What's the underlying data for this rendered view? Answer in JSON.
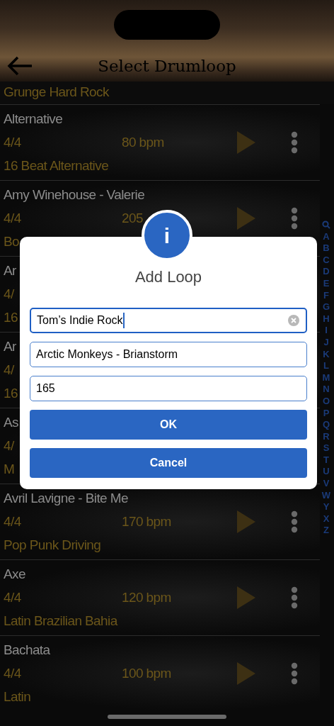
{
  "header": {
    "title": "Select Drumloop"
  },
  "partial_row": {
    "style": "Grunge Hard Rock"
  },
  "rows": [
    {
      "name": "Alternative",
      "meter": "4/4",
      "bpm": "80 bpm",
      "style": "16 Beat Alternative",
      "buttons_shown": true
    },
    {
      "name": "Amy Winehouse - Valerie",
      "meter": "4/4",
      "bpm": "205",
      "style": "Bo",
      "buttons_shown": true
    },
    {
      "name": "Ar",
      "meter": "4/",
      "bpm": "",
      "style": "16",
      "buttons_shown": false
    },
    {
      "name": "Ar",
      "meter": "4/",
      "bpm": "",
      "style": "16",
      "buttons_shown": false
    },
    {
      "name": "As",
      "meter": "4/",
      "bpm": "",
      "style": "M",
      "buttons_shown": false
    },
    {
      "name": "Avril Lavigne - Bite Me",
      "meter": "4/4",
      "bpm": "170 bpm",
      "style": "Pop Punk Driving",
      "buttons_shown": true
    },
    {
      "name": "Axe",
      "meter": "4/4",
      "bpm": "120 bpm",
      "style": "Latin Brazilian Bahia",
      "buttons_shown": true
    },
    {
      "name": "Bachata",
      "meter": "4/4",
      "bpm": "100 bpm",
      "style": "Latin",
      "buttons_shown": true
    }
  ],
  "index": [
    "A",
    "B",
    "C",
    "D",
    "E",
    "F",
    "G",
    "H",
    "I",
    "J",
    "K",
    "L",
    "M",
    "N",
    "O",
    "P",
    "Q",
    "R",
    "S",
    "T",
    "U",
    "V",
    "W",
    "Y",
    "X",
    "Z"
  ],
  "dialog": {
    "icon": "i",
    "title": "Add Loop",
    "fields": [
      {
        "value": "Tom’s Indie Rock",
        "focused": true
      },
      {
        "value": "Arctic Monkeys - Brianstorm",
        "focused": false
      },
      {
        "value": "165",
        "focused": false
      }
    ],
    "buttons": [
      "OK",
      "Cancel"
    ]
  }
}
